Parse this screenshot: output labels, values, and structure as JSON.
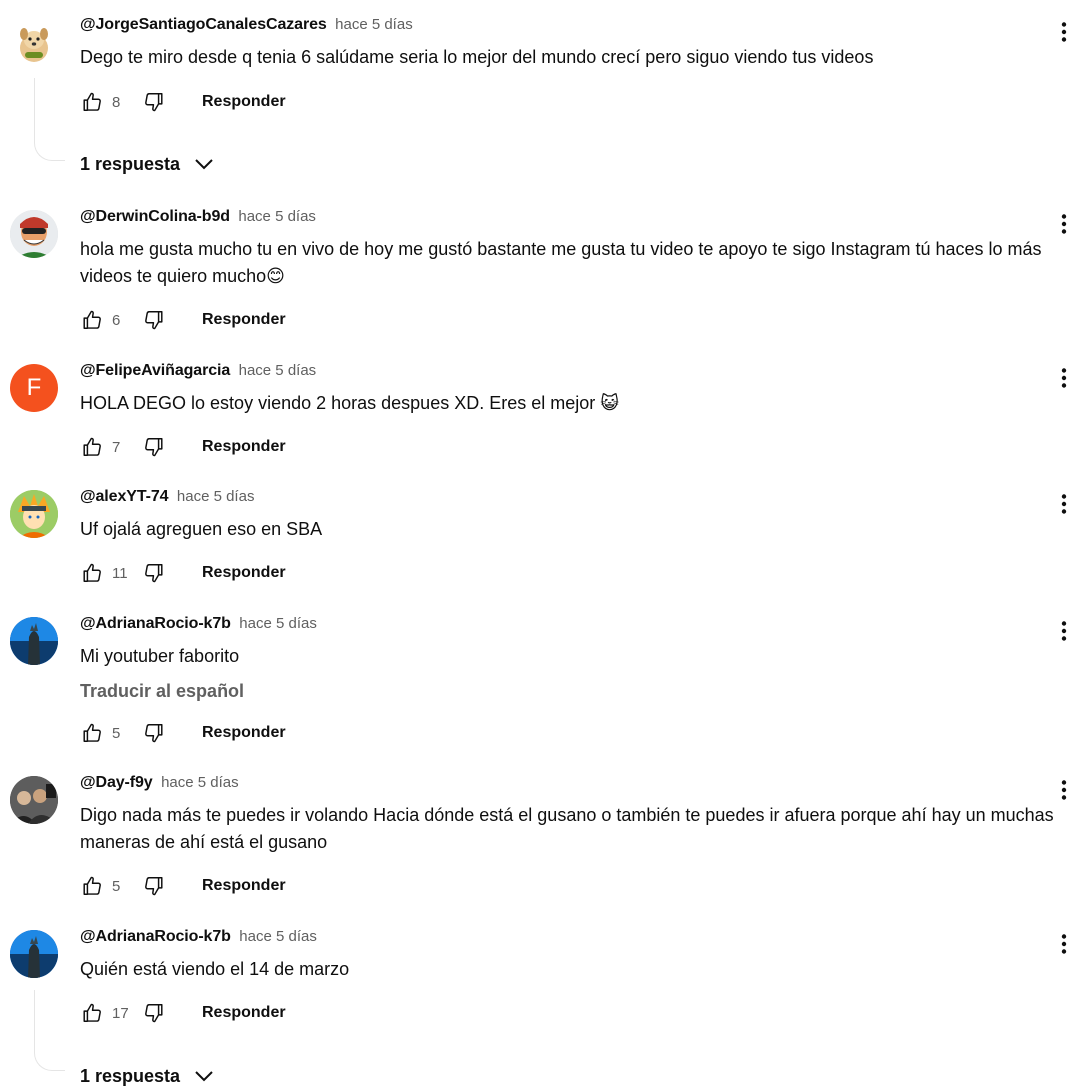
{
  "comments": [
    {
      "author": "@JorgeSantiagoCanalesCazares",
      "time": "hace 5 días",
      "text": "Dego te miro desde q tenia 6 salúdame seria lo mejor del mundo crecí pero siguo viendo tus videos",
      "likes": "8",
      "reply_label": "Responder",
      "replies_label": "1 respuesta",
      "avatar_icon": "dog-avatar-icon"
    },
    {
      "author": "@DerwinColina-b9d",
      "time": "hace 5 días",
      "text": "hola me gusta mucho tu en vivo de hoy me gustó bastante me gusta tu video te apoyo te sigo Instagram tú haces lo más videos te quiero mucho😊",
      "likes": "6",
      "reply_label": "Responder",
      "avatar_icon": "cartoon-character-avatar-icon"
    },
    {
      "author": "@FelipeAviñagarcia",
      "time": "hace 5 días",
      "text": "HOLA DEGO lo estoy viendo 2 horas despues XD. Eres el mejor 😺",
      "likes": "7",
      "reply_label": "Responder",
      "avatar_letter": "F",
      "avatar_color": "#f4511e"
    },
    {
      "author": "@alexYT-74",
      "time": "hace 5 días",
      "text": "Uf ojalá agreguen eso en SBA",
      "likes": "11",
      "reply_label": "Responder",
      "avatar_icon": "anime-character-avatar-icon"
    },
    {
      "author": "@AdrianaRocio-k7b",
      "time": "hace 5 días",
      "text": "Mi youtuber faborito",
      "translate_label": "Traducir al español",
      "likes": "5",
      "reply_label": "Responder",
      "avatar_icon": "monster-avatar-icon"
    },
    {
      "author": "@Day-f9y",
      "time": "hace 5 días",
      "text": "Digo nada más te puedes ir volando Hacia dónde está el gusano o también te puedes ir afuera porque ahí hay un muchas maneras de ahí está el gusano",
      "likes": "5",
      "reply_label": "Responder",
      "avatar_icon": "group-photo-avatar-icon"
    },
    {
      "author": "@AdrianaRocio-k7b",
      "time": "hace 5 días",
      "text": "Quién está viendo el 14 de marzo",
      "likes": "17",
      "reply_label": "Responder",
      "replies_label": "1 respuesta",
      "avatar_icon": "monster-avatar-icon"
    }
  ],
  "icons": {
    "like": "thumbs-up-icon",
    "dislike": "thumbs-down-icon",
    "more": "more-vert-icon",
    "expand": "chevron-down-icon"
  },
  "colors": {
    "text": "#0f0f0f",
    "secondary": "#606060",
    "avatar_f": "#f4511e"
  }
}
